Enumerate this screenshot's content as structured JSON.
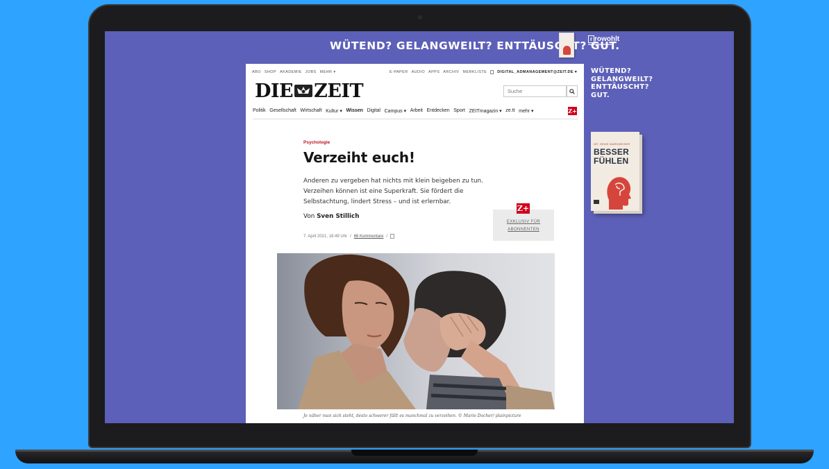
{
  "ad": {
    "banner_text": "WÜTEND? GELANGWEILT? ENTTÄUSCHT? GUT.",
    "publisher": "rowohlt",
    "side_lines": [
      "WÜTEND?",
      "GELANGWEILT?",
      "ENTTÄUSCHT?",
      "GUT."
    ],
    "book_author": "DR. HEIKE MARKWEISER",
    "book_title_1": "BESSER",
    "book_title_2": "FÜHLEN"
  },
  "site": {
    "utility_left": [
      "ABO",
      "SHOP",
      "AKADEMIE",
      "JOBS",
      "MEHR ▾"
    ],
    "utility_right": [
      "E-PAPER",
      "AUDIO",
      "APPS",
      "ARCHIV",
      "MERKLISTE"
    ],
    "account_email": "DIGITAL_ADMANAGEMENT@ZEIT.DE ▾",
    "logo_left": "DIE",
    "logo_right": "ZEIT",
    "search_placeholder": "Suche",
    "nav": [
      "Politik",
      "Gesellschaft",
      "Wirtschaft",
      "Kultur ▾",
      "Wissen",
      "Digital",
      "Campus ▾",
      "Arbeit",
      "Entdecken",
      "Sport",
      "ZEITmagazin ▾",
      "ze.tt",
      "mehr ▾"
    ],
    "nav_active": "Wissen",
    "zplus_label": "Z+"
  },
  "article": {
    "kicker": "Psychologie",
    "headline": "Verzeiht euch!",
    "teaser": "Anderen zu vergeben hat nichts mit klein beigeben zu tun. Verzeihen können ist eine Superkraft. Sie fördert die Selbstachtung, lindert Stress – und ist erlernbar.",
    "byline_prefix": "Von",
    "author": "Sven Stillich",
    "date": "7. April 2021, 18:49 Uhr",
    "separator": "/",
    "comments": "66 Kommentare",
    "exclusive_line1": "EXKLUSIV FÜR",
    "exclusive_line2": "ABONNENTEN",
    "caption": "Je näher man sich steht, desto schwerer fällt es manchmal zu verzeihen. © Marie Docher/ plainpicture"
  },
  "colors": {
    "background": "#2ea3ff",
    "ad_purple": "#5d60b8",
    "zeit_red": "#d0021b"
  }
}
